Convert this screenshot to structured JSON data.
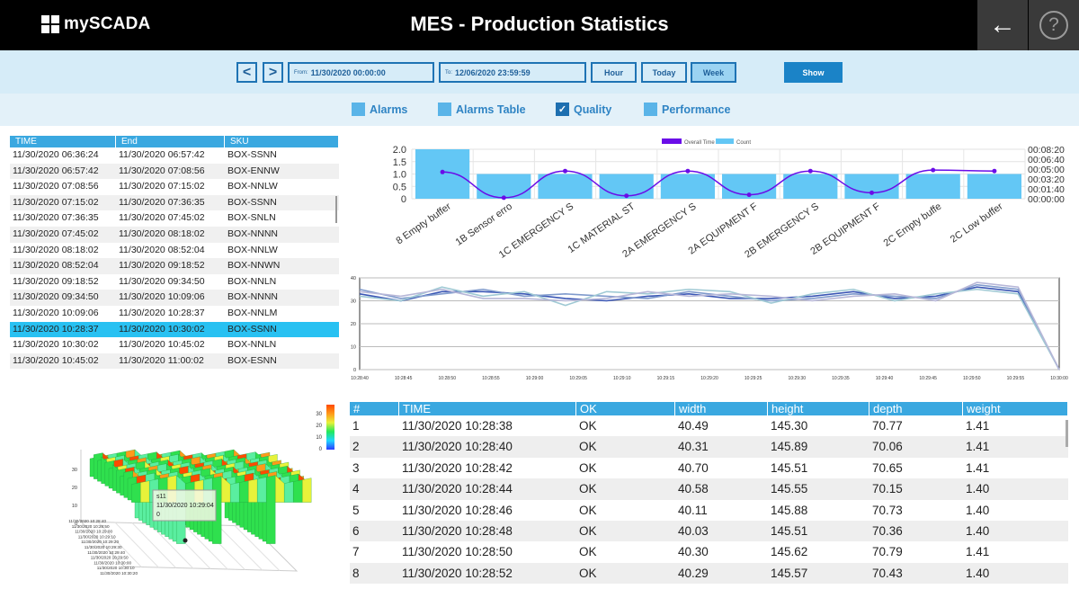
{
  "header": {
    "logo_text": "mySCADA",
    "title": "MES - Production Statistics",
    "back_icon": "arrow-left-icon",
    "help_label": "?"
  },
  "toolbar": {
    "prev_label": "<",
    "next_label": ">",
    "from_prefix": "From:",
    "from_value": "11/30/2020 00:00:00",
    "to_prefix": "To:",
    "to_value": "12/06/2020 23:59:59",
    "hour_label": "Hour",
    "today_label": "Today",
    "week_label": "Week",
    "active_period": "Week",
    "show_label": "Show"
  },
  "filters": [
    {
      "label": "Alarms",
      "checked": false
    },
    {
      "label": "Alarms Table",
      "checked": false
    },
    {
      "label": "Quality",
      "checked": true
    },
    {
      "label": "Performance",
      "checked": false
    }
  ],
  "alarm_table": {
    "columns": [
      "TIME",
      "End",
      "SKU"
    ],
    "selected_index": 11,
    "rows": [
      [
        "11/30/2020 06:36:24",
        "11/30/2020 06:57:42",
        "BOX-SSNN"
      ],
      [
        "11/30/2020 06:57:42",
        "11/30/2020 07:08:56",
        "BOX-ENNW"
      ],
      [
        "11/30/2020 07:08:56",
        "11/30/2020 07:15:02",
        "BOX-NNLW"
      ],
      [
        "11/30/2020 07:15:02",
        "11/30/2020 07:36:35",
        "BOX-SSNN"
      ],
      [
        "11/30/2020 07:36:35",
        "11/30/2020 07:45:02",
        "BOX-SNLN"
      ],
      [
        "11/30/2020 07:45:02",
        "11/30/2020 08:18:02",
        "BOX-NNNN"
      ],
      [
        "11/30/2020 08:18:02",
        "11/30/2020 08:52:04",
        "BOX-NNLW"
      ],
      [
        "11/30/2020 08:52:04",
        "11/30/2020 09:18:52",
        "BOX-NNWN"
      ],
      [
        "11/30/2020 09:18:52",
        "11/30/2020 09:34:50",
        "BOX-NNLN"
      ],
      [
        "11/30/2020 09:34:50",
        "11/30/2020 10:09:06",
        "BOX-NNNN"
      ],
      [
        "11/30/2020 10:09:06",
        "11/30/2020 10:28:37",
        "BOX-NNLM"
      ],
      [
        "11/30/2020 10:28:37",
        "11/30/2020 10:30:02",
        "BOX-SSNN"
      ],
      [
        "11/30/2020 10:30:02",
        "11/30/2020 10:45:02",
        "BOX-NNLN"
      ],
      [
        "11/30/2020 10:45:02",
        "11/30/2020 11:00:02",
        "BOX-ESNN"
      ]
    ]
  },
  "chart_data": [
    {
      "type": "bar",
      "legend": [
        "Overall Time",
        "Count"
      ],
      "legend_position": "top",
      "categories": [
        "8 Empty buffer",
        "1B Sensor erro",
        "1C EMERGENCY S",
        "1C MATERIAL ST",
        "2A EMERGENCY S",
        "2A EQUIPMENT F",
        "2B EMERGENCY S",
        "2B EQUIPMENT F",
        "2C Empty buffe",
        "2C Low buffer"
      ],
      "series": [
        {
          "name": "Count",
          "axis": "left",
          "values": [
            2,
            1,
            1,
            1,
            1,
            1,
            1,
            1,
            1,
            1
          ]
        },
        {
          "name": "Overall Time",
          "axis": "right",
          "unit": "seconds",
          "values": [
            270,
            10,
            280,
            30,
            280,
            40,
            280,
            60,
            290,
            280
          ]
        }
      ],
      "y_ticks": [
        "2.0",
        "1.5",
        "1.0",
        "0.5",
        "0"
      ],
      "ylim": [
        0,
        2
      ],
      "y2_ticks": [
        "00:08:20",
        "00:06:40",
        "00:05:00",
        "00:03:20",
        "00:01:40",
        "00:00:00"
      ],
      "y2lim": [
        0,
        500
      ],
      "grid": true,
      "colors": {
        "bar": "#63c7f5",
        "line": "#6a0de8"
      }
    },
    {
      "type": "line",
      "x_ticks": [
        "10:28:40",
        "10:28:45",
        "10:28:50",
        "10:28:55",
        "10:29:00",
        "10:29:05",
        "10:29:10",
        "10:29:15",
        "10:29:20",
        "10:29:25",
        "10:29:30",
        "10:29:35",
        "10:29:40",
        "10:29:45",
        "10:29:50",
        "10:29:55",
        "10:30:00"
      ],
      "y_ticks": [
        "40",
        "30",
        "20",
        "10",
        "0"
      ],
      "ylim": [
        0,
        40
      ],
      "grid": true,
      "series": [
        {
          "color": "#3b57b5",
          "values": [
            33,
            30,
            34,
            34,
            33,
            31,
            30,
            32,
            33,
            31,
            31,
            32,
            34,
            31,
            32,
            36,
            34,
            0
          ]
        },
        {
          "color": "#7f9acc",
          "values": [
            35,
            31,
            33,
            35,
            32,
            33,
            32,
            31,
            34,
            32,
            30,
            31,
            33,
            32,
            31,
            37,
            35,
            0
          ]
        },
        {
          "color": "#9fc9d4",
          "values": [
            32,
            30,
            36,
            32,
            34,
            28,
            34,
            33,
            35,
            34,
            29,
            33,
            35,
            30,
            33,
            35,
            33,
            0
          ]
        },
        {
          "color": "#b7b7d8",
          "values": [
            34,
            32,
            35,
            31,
            31,
            30,
            31,
            34,
            32,
            33,
            32,
            30,
            32,
            33,
            30,
            38,
            36,
            0
          ]
        }
      ]
    },
    {
      "type": "heatmap",
      "variant": "3d-surface",
      "z_ticks": [
        "30",
        "20",
        "10",
        "0"
      ],
      "colorbar_ticks": [
        "30",
        "20",
        "10",
        "0"
      ],
      "colors": [
        "#2b3cff",
        "#1fd6ff",
        "#22e85a",
        "#e7f23a",
        "#ff9a1a",
        "#ff4a00"
      ],
      "x_labels": [
        "11/30/2020 10:28:40",
        "11/30/2020 10:28:50",
        "11/30/2020 10:29:00",
        "11/30/2020 10:29:10",
        "11/30/2020 10:29:20",
        "11/30/2020 10:29:30",
        "11/30/2020 10:29:40",
        "11/30/2020 10:29:50",
        "11/30/2020 10:30:00",
        "11/30/2020 10:30:10",
        "11/30/2020 10:30:20"
      ],
      "tooltip": {
        "series": "s11",
        "time": "11/30/2020 10:29:04",
        "value": "0"
      }
    }
  ],
  "measurements": {
    "columns": [
      "#",
      "TIME",
      "OK",
      "width",
      "height",
      "depth",
      "weight"
    ],
    "rows": [
      [
        "1",
        "11/30/2020 10:28:38",
        "OK",
        "40.49",
        "145.30",
        "70.77",
        "1.41"
      ],
      [
        "2",
        "11/30/2020 10:28:40",
        "OK",
        "40.31",
        "145.89",
        "70.06",
        "1.41"
      ],
      [
        "3",
        "11/30/2020 10:28:42",
        "OK",
        "40.70",
        "145.51",
        "70.65",
        "1.41"
      ],
      [
        "4",
        "11/30/2020 10:28:44",
        "OK",
        "40.58",
        "145.55",
        "70.15",
        "1.40"
      ],
      [
        "5",
        "11/30/2020 10:28:46",
        "OK",
        "40.11",
        "145.88",
        "70.73",
        "1.40"
      ],
      [
        "6",
        "11/30/2020 10:28:48",
        "OK",
        "40.03",
        "145.51",
        "70.36",
        "1.40"
      ],
      [
        "7",
        "11/30/2020 10:28:50",
        "OK",
        "40.30",
        "145.62",
        "70.79",
        "1.41"
      ],
      [
        "8",
        "11/30/2020 10:28:52",
        "OK",
        "40.29",
        "145.57",
        "70.43",
        "1.40"
      ]
    ]
  }
}
